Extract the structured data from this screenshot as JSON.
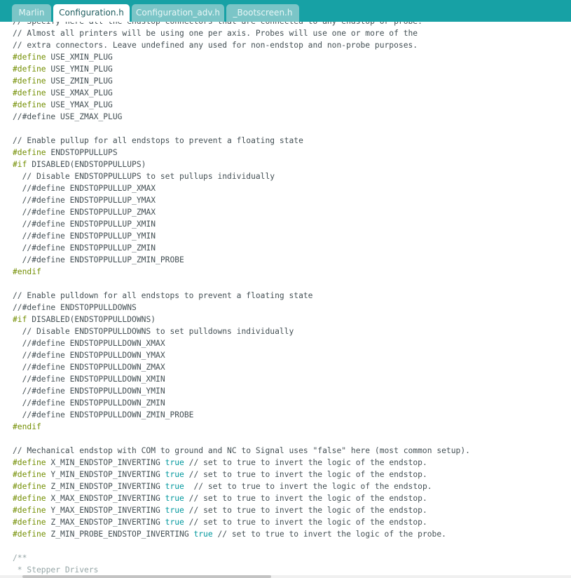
{
  "tabs": [
    {
      "label": "Marlin",
      "active": false
    },
    {
      "label": "Configuration.h",
      "active": true
    },
    {
      "label": "Configuration_adv.h",
      "active": false
    },
    {
      "label": "_Bootscreen.h",
      "active": false
    }
  ],
  "colors": {
    "tabbar": "#17a1a5",
    "preprocessor": "#728e00",
    "keyword": "#00979d",
    "text": "#434f54"
  },
  "code": [
    [
      [
        "tx",
        "// Specify here all the endstop connectors that are connected to any endstop or probe."
      ]
    ],
    [
      [
        "tx",
        "// Almost all printers will be using one per axis. Probes will use one or more of the"
      ]
    ],
    [
      [
        "tx",
        "// extra connectors. Leave undefined any used for non-endstop and non-probe purposes."
      ]
    ],
    [
      [
        "pp",
        "#define"
      ],
      [
        "tx",
        " USE_XMIN_PLUG"
      ]
    ],
    [
      [
        "pp",
        "#define"
      ],
      [
        "tx",
        " USE_YMIN_PLUG"
      ]
    ],
    [
      [
        "pp",
        "#define"
      ],
      [
        "tx",
        " USE_ZMIN_PLUG"
      ]
    ],
    [
      [
        "pp",
        "#define"
      ],
      [
        "tx",
        " USE_XMAX_PLUG"
      ]
    ],
    [
      [
        "pp",
        "#define"
      ],
      [
        "tx",
        " USE_YMAX_PLUG"
      ]
    ],
    [
      [
        "tx",
        "//#define USE_ZMAX_PLUG"
      ]
    ],
    [],
    [
      [
        "tx",
        "// Enable pullup for all endstops to prevent a floating state"
      ]
    ],
    [
      [
        "pp",
        "#define"
      ],
      [
        "tx",
        " ENDSTOPPULLUPS"
      ]
    ],
    [
      [
        "pp",
        "#if"
      ],
      [
        "tx",
        " DISABLED(ENDSTOPPULLUPS)"
      ]
    ],
    [
      [
        "tx",
        "  // Disable ENDSTOPPULLUPS to set pullups individually"
      ]
    ],
    [
      [
        "tx",
        "  //#define ENDSTOPPULLUP_XMAX"
      ]
    ],
    [
      [
        "tx",
        "  //#define ENDSTOPPULLUP_YMAX"
      ]
    ],
    [
      [
        "tx",
        "  //#define ENDSTOPPULLUP_ZMAX"
      ]
    ],
    [
      [
        "tx",
        "  //#define ENDSTOPPULLUP_XMIN"
      ]
    ],
    [
      [
        "tx",
        "  //#define ENDSTOPPULLUP_YMIN"
      ]
    ],
    [
      [
        "tx",
        "  //#define ENDSTOPPULLUP_ZMIN"
      ]
    ],
    [
      [
        "tx",
        "  //#define ENDSTOPPULLUP_ZMIN_PROBE"
      ]
    ],
    [
      [
        "pp",
        "#endif"
      ]
    ],
    [],
    [
      [
        "tx",
        "// Enable pulldown for all endstops to prevent a floating state"
      ]
    ],
    [
      [
        "tx",
        "//#define ENDSTOPPULLDOWNS"
      ]
    ],
    [
      [
        "pp",
        "#if"
      ],
      [
        "tx",
        " DISABLED(ENDSTOPPULLDOWNS)"
      ]
    ],
    [
      [
        "tx",
        "  // Disable ENDSTOPPULLDOWNS to set pulldowns individually"
      ]
    ],
    [
      [
        "tx",
        "  //#define ENDSTOPPULLDOWN_XMAX"
      ]
    ],
    [
      [
        "tx",
        "  //#define ENDSTOPPULLDOWN_YMAX"
      ]
    ],
    [
      [
        "tx",
        "  //#define ENDSTOPPULLDOWN_ZMAX"
      ]
    ],
    [
      [
        "tx",
        "  //#define ENDSTOPPULLDOWN_XMIN"
      ]
    ],
    [
      [
        "tx",
        "  //#define ENDSTOPPULLDOWN_YMIN"
      ]
    ],
    [
      [
        "tx",
        "  //#define ENDSTOPPULLDOWN_ZMIN"
      ]
    ],
    [
      [
        "tx",
        "  //#define ENDSTOPPULLDOWN_ZMIN_PROBE"
      ]
    ],
    [
      [
        "pp",
        "#endif"
      ]
    ],
    [],
    [
      [
        "tx",
        "// Mechanical endstop with COM to ground and NC to Signal uses \"false\" here (most common setup)."
      ]
    ],
    [
      [
        "pp",
        "#define"
      ],
      [
        "tx",
        " X_MIN_ENDSTOP_INVERTING "
      ],
      [
        "kw",
        "true"
      ],
      [
        "tx",
        " // set to true to invert the logic of the endstop."
      ]
    ],
    [
      [
        "pp",
        "#define"
      ],
      [
        "tx",
        " Y_MIN_ENDSTOP_INVERTING "
      ],
      [
        "kw",
        "true"
      ],
      [
        "tx",
        " // set to true to invert the logic of the endstop."
      ]
    ],
    [
      [
        "pp",
        "#define"
      ],
      [
        "tx",
        " Z_MIN_ENDSTOP_INVERTING "
      ],
      [
        "kw",
        "true"
      ],
      [
        "tx",
        "  // set to true to invert the logic of the endstop."
      ]
    ],
    [
      [
        "pp",
        "#define"
      ],
      [
        "tx",
        " X_MAX_ENDSTOP_INVERTING "
      ],
      [
        "kw",
        "true"
      ],
      [
        "tx",
        " // set to true to invert the logic of the endstop."
      ]
    ],
    [
      [
        "pp",
        "#define"
      ],
      [
        "tx",
        " Y_MAX_ENDSTOP_INVERTING "
      ],
      [
        "kw",
        "true"
      ],
      [
        "tx",
        " // set to true to invert the logic of the endstop."
      ]
    ],
    [
      [
        "pp",
        "#define"
      ],
      [
        "tx",
        " Z_MAX_ENDSTOP_INVERTING "
      ],
      [
        "kw",
        "true"
      ],
      [
        "tx",
        " // set to true to invert the logic of the endstop."
      ]
    ],
    [
      [
        "pp",
        "#define"
      ],
      [
        "tx",
        " Z_MIN_PROBE_ENDSTOP_INVERTING "
      ],
      [
        "kw",
        "true"
      ],
      [
        "tx",
        " // set to true to invert the logic of the probe."
      ]
    ],
    [],
    [
      [
        "cm",
        "/**"
      ]
    ],
    [
      [
        "cm",
        " * Stepper Drivers"
      ]
    ]
  ]
}
